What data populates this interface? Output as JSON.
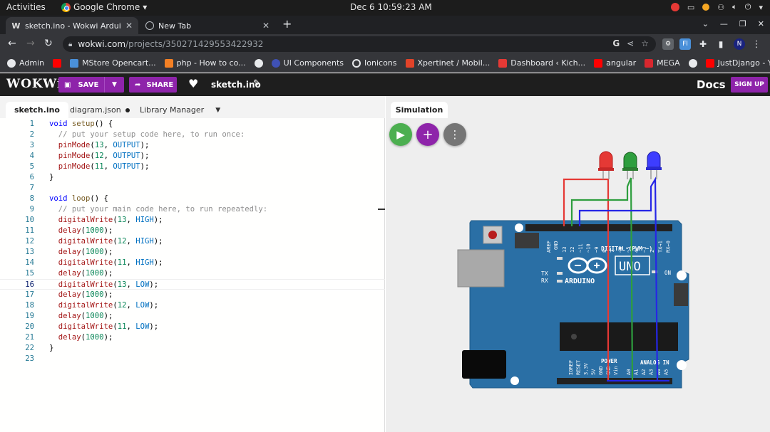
{
  "os": {
    "activities": "Activities",
    "app_name": "Google Chrome",
    "clock": "Dec 6  10:59:23 AM"
  },
  "browser": {
    "tabs": [
      {
        "title": "sketch.ino - Wokwi Arduino an",
        "favicon": "W",
        "active": true
      },
      {
        "title": "New Tab",
        "favicon": "globe-icon",
        "active": false
      }
    ],
    "url_host": "wokwi.com",
    "url_path": "/projects/350271429553422932",
    "bookmarks": [
      {
        "label": "Admin",
        "color": "#e8eaed"
      },
      {
        "label": "",
        "color": "#ff0000"
      },
      {
        "label": "MStore Opencart...",
        "color": "#4a90d9"
      },
      {
        "label": "php - How to co...",
        "color": "#f48024"
      },
      {
        "label": "",
        "color": "#e8eaed"
      },
      {
        "label": "UI Components",
        "color": "#3f51b5"
      },
      {
        "label": "Ionicons",
        "color": "#e8eaed"
      },
      {
        "label": "Xpertinet / Mobil...",
        "color": "#e24329"
      },
      {
        "label": "Dashboard ‹ Kich...",
        "color": "#e53935"
      },
      {
        "label": "angular",
        "color": "#ff0000"
      },
      {
        "label": "MEGA",
        "color": "#d9272e"
      },
      {
        "label": "",
        "color": "#e8eaed"
      },
      {
        "label": "JustDjango - You...",
        "color": "#ff0000"
      }
    ],
    "more_bookmarks": "»"
  },
  "wokwi": {
    "logo": "WOKWi",
    "save_label": "SAVE",
    "share_label": "SHARE",
    "project_name": "sketch.ino",
    "docs_label": "Docs",
    "signup_label": "SIGN UP",
    "editor_tabs": {
      "sketch": "sketch.ino",
      "diagram": "diagram.json",
      "library": "Library Manager"
    },
    "simulation_tab": "Simulation",
    "colors": {
      "accent": "#8e24aa",
      "play": "#4caf50",
      "more": "#757575",
      "board": "#2a6fa5"
    }
  },
  "code": [
    "void setup() {",
    "  // put your setup code here, to run once:",
    "  pinMode(13, OUTPUT);",
    "  pinMode(12, OUTPUT);",
    "  pinMode(11, OUTPUT);",
    "}",
    "",
    "void loop() {",
    "  // put your main code here, to run repeatedly:",
    "  digitalWrite(13, HIGH);",
    "  delay(1000);",
    "  digitalWrite(12, HIGH);",
    "  delay(1000);",
    "  digitalWrite(11, HIGH);",
    "  delay(1000);",
    "  digitalWrite(13, LOW);",
    "  delay(1000);",
    "  digitalWrite(12, LOW);",
    "  delay(1000);",
    "  digitalWrite(11, LOW);",
    "  delay(1000);",
    "}",
    ""
  ],
  "current_line": 16,
  "board": {
    "brand": "ARDUINO",
    "model": "UNO",
    "digital_label": "DIGITAL (PWM ~)",
    "analog_label": "ANALOG IN",
    "power_label": "POWER",
    "aref": "AREF",
    "gnd": "GND",
    "tx": "TX",
    "rx": "RX",
    "on": "ON",
    "digital_pins": [
      "13",
      "12",
      "~11",
      "~10",
      "~9",
      "8",
      "7",
      "~6",
      "~5",
      "4",
      "~3",
      "2",
      "TX→1",
      "RX←0"
    ],
    "power_pins": [
      "IOREF",
      "RESET",
      "3.3V",
      "5V",
      "GND",
      "GND",
      "Vin"
    ],
    "analog_pins": [
      "A0",
      "A1",
      "A2",
      "A3",
      "A4",
      "A5"
    ]
  },
  "leds": [
    {
      "color": "red",
      "hex": "#e53935"
    },
    {
      "color": "green",
      "hex": "#2e9e3e"
    },
    {
      "color": "blue",
      "hex": "#3d3dff"
    }
  ]
}
